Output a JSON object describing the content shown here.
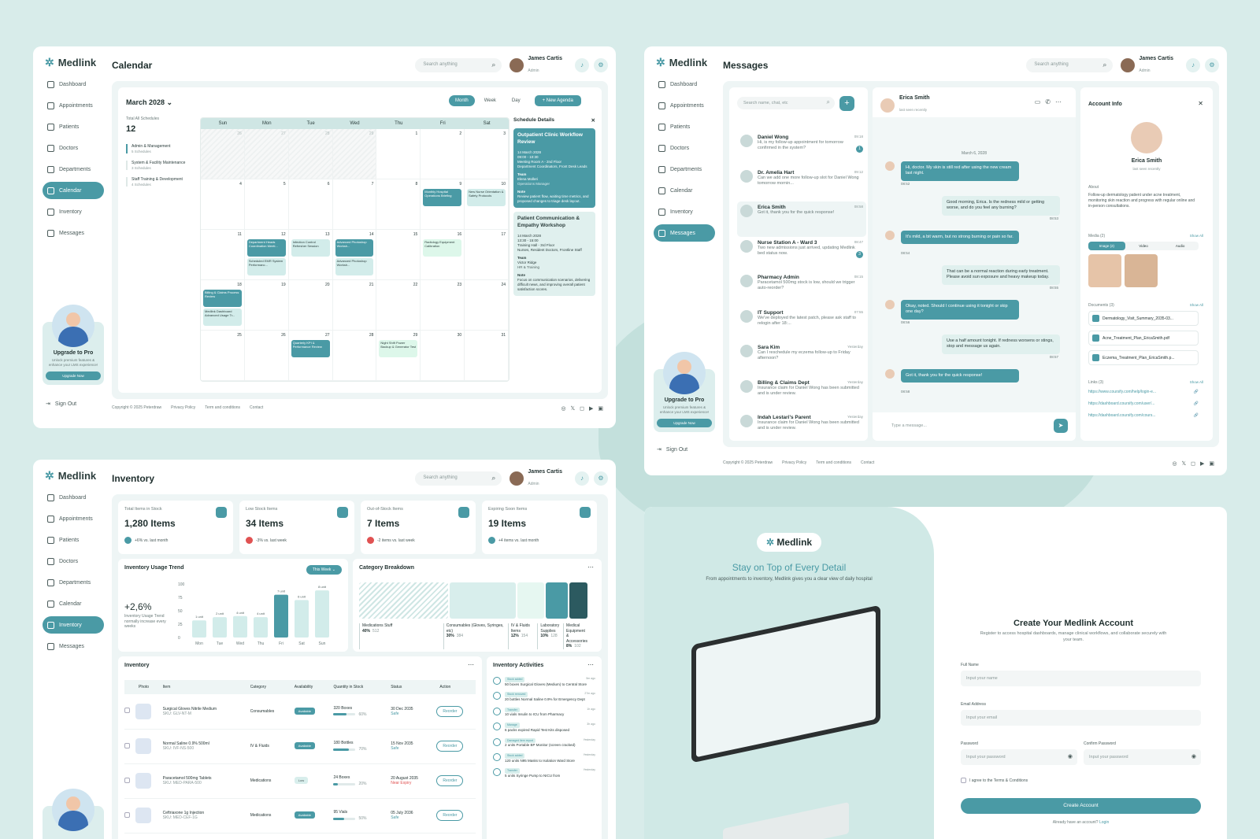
{
  "brand": "Medlink",
  "user": {
    "name": "James Cartis",
    "role": "Admin"
  },
  "search_placeholder": "Search anything",
  "nav": [
    "Dashboard",
    "Appointments",
    "Patients",
    "Doctors",
    "Departments",
    "Calendar",
    "Inventory",
    "Messages"
  ],
  "upgrade": {
    "title": "Upgrade to Pro",
    "text": "Unlock premium features & enhance your LMS experience!",
    "button": "Upgrade Now"
  },
  "signout": "Sign Out",
  "footer": {
    "copy": "Copyright © 2025 Peterdraw",
    "privacy": "Privacy Policy",
    "terms": "Term and conditions",
    "contact": "Contact"
  },
  "calendar": {
    "title": "Calendar",
    "month": "March 2028",
    "views": [
      "Month",
      "Week",
      "Day"
    ],
    "new_agenda": "+ New Agenda",
    "total_label": "Total All Schedules",
    "total": "12",
    "groups": [
      {
        "name": "Admin & Management",
        "count": "5 Schedules"
      },
      {
        "name": "System & Facility Maintenance",
        "count": "3 Schedules"
      },
      {
        "name": "Staff Training & Development",
        "count": "4 Schedules"
      }
    ],
    "weekdays": [
      "Sun",
      "Mon",
      "Tue",
      "Wed",
      "Thu",
      "Fri",
      "Sat"
    ],
    "days": [
      "26",
      "27",
      "28",
      "29",
      "1",
      "2",
      "3",
      "4",
      "5",
      "6",
      "7",
      "8",
      "9",
      "10",
      "11",
      "12",
      "13",
      "14",
      "15",
      "16",
      "17",
      "18",
      "19",
      "20",
      "21",
      "22",
      "23",
      "24",
      "25",
      "26",
      "27",
      "28",
      "29",
      "30",
      "31"
    ],
    "events": [
      {
        "day": "9",
        "text": "Monthly Hospital Operations Briefing",
        "style": "d"
      },
      {
        "day": "10",
        "text": "New Nurse Orientation & Safety Protocols",
        "style": "l"
      },
      {
        "day": "12",
        "text": "Department Heads Coordination Meeti...",
        "style": "d"
      },
      {
        "day": "12",
        "text": "Scheduled EMR System Performanc...",
        "style": "l"
      },
      {
        "day": "13",
        "text": "Infection Control Refresher Session",
        "style": "l"
      },
      {
        "day": "14",
        "text": "Advanced Photoshop Worksh...",
        "style": "d"
      },
      {
        "day": "14",
        "text": "Advanced Photoshop Worksh...",
        "style": "l"
      },
      {
        "day": "16",
        "text": "Radiology Equipment Calibration",
        "style": "g"
      },
      {
        "day": "18",
        "text": "Billing & Claims Process Review",
        "style": "d"
      },
      {
        "day": "18",
        "text": "Medlink Dashboard Advanced Usage Tr...",
        "style": "l"
      },
      {
        "day": "27",
        "text": "Quarterly KPI & Performance Review",
        "style": "d"
      },
      {
        "day": "29",
        "text": "Night Shift Power Backup & Generator Test",
        "style": "g"
      }
    ],
    "details_title": "Schedule Details",
    "details": [
      {
        "title": "Outpatient Clinic Workflow Review",
        "date": "14 March 2028",
        "time": "09:00 - 10:30",
        "place": "Meeting Room A - 2nd Floor",
        "who": "Department Coordinators, Front Desk Leads",
        "team": "Elena Molleri",
        "team_role": "Operations Manager",
        "note": "Review patient flow, waiting time metrics, and proposed changes to triage desk layout."
      },
      {
        "title": "Patient Communication & Empathy Workshop",
        "date": "14 March 2028",
        "time": "13:30 - 15:00",
        "place": "Training Hall - 3rd Floor",
        "who": "Nurses, Resident Doctors, Frontline Staff",
        "team": "Victor Ridge",
        "team_role": "HR & Training",
        "note": "Focus on communication scenarios, delivering difficult news, and improving overall patient satisfaction scores."
      }
    ]
  },
  "messages": {
    "title": "Messages",
    "search": "Search name, chat, etc",
    "chats": [
      {
        "name": "Daniel Wong",
        "time": "09:18",
        "text": "Hi, is my follow-up appointment for tomorrow confirmed in the system?",
        "badge": "1"
      },
      {
        "name": "Dr. Amelia Hart",
        "time": "09:12",
        "text": "Can we add one more follow-up slot for Daniel Wong tomorrow mornin...",
        "badge": ""
      },
      {
        "name": "Erica Smith",
        "time": "08:58",
        "text": "Got it, thank you for the quick response!",
        "badge": ""
      },
      {
        "name": "Nurse Station A - Ward 3",
        "time": "08:47",
        "text": "Two new admissions just arrived, updating Medlink bed status now.",
        "badge": "3"
      },
      {
        "name": "Pharmacy Admin",
        "time": "08:15",
        "text": "Paracetamol 500mg stock is low, should we trigger auto-reorder?",
        "badge": ""
      },
      {
        "name": "IT Support",
        "time": "07:55",
        "text": "We've deployed the latest patch, please ask staff to relogin after 18:...",
        "badge": ""
      },
      {
        "name": "Sara Kim",
        "time": "Yesterday",
        "text": "Can I reschedule my eczema follow-up to Friday afternoon?",
        "badge": ""
      },
      {
        "name": "Billing & Claims Dept",
        "time": "Yesterday",
        "text": "Insurance claim for Daniel Wong has been submitted and is under review.",
        "badge": ""
      },
      {
        "name": "Indah Lestari's Parent",
        "time": "Yesterday",
        "text": "Insurance claim for Daniel Wong has been submitted and is under review.",
        "badge": ""
      }
    ],
    "contact": {
      "name": "Erica Smith",
      "status": "last seen recently"
    },
    "date": "March 6, 2028",
    "thread": [
      {
        "dir": "in",
        "text": "Hi, doctor. My skin is still red after using the new cream last night.",
        "time": "08:52"
      },
      {
        "dir": "out",
        "text": "Good morning, Erica. Is the redness mild or getting worse, and do you feel any burning?",
        "time": "08:53"
      },
      {
        "dir": "in",
        "text": "It's mild, a bit warm, but no strong burning or pain so far.",
        "time": "08:54"
      },
      {
        "dir": "out",
        "text": "That can be a normal reaction during early treatment. Please avoid sun exposure and heavy makeup today.",
        "time": "08:55"
      },
      {
        "dir": "in",
        "text": "Okay, noted. Should I continue using it tonight or skip one day?",
        "time": "08:56"
      },
      {
        "dir": "out",
        "text": "Use a half amount tonight. If redness worsens or stings, stop and message us again.",
        "time": "08:57"
      },
      {
        "dir": "in",
        "text": "Got it, thank you for the quick response!",
        "time": "08:58"
      }
    ],
    "input": "Type a message...",
    "account": {
      "title": "Account Info",
      "name": "Erica Smith",
      "status": "last seen recently",
      "about_label": "About",
      "about": "Follow-up dermatology patient under acne treatment, monitoring skin reaction and progress with regular online and in-person consultations.",
      "media_label": "Media (2)",
      "show_all": "Show All",
      "tabs": [
        "Image (2)",
        "Video",
        "Audio"
      ],
      "docs_label": "Documents (3)",
      "docs": [
        "Dermatology_Visit_Summary_2035-03...",
        "Acne_Treatment_Plan_EricaSmith.pdf",
        "Eczema_Treatment_Plan_EricaSmith.p..."
      ],
      "links_label": "Links (3)",
      "links": [
        "https://www.coursify.com/help/login-e...",
        "https://dashboard.coursify.com/user/...",
        "https://dashboard.coursify.com/cours..."
      ]
    }
  },
  "inventory": {
    "title": "Inventory",
    "kpis": [
      {
        "label": "Total Items in Stock",
        "value": "1,280 Items",
        "change": "+6% vs. last month",
        "color": "#4a9aa5"
      },
      {
        "label": "Low Stock Items",
        "value": "34 Items",
        "change": "-3% vs. last week",
        "color": "#e05252"
      },
      {
        "label": "Out-of-Stock Items",
        "value": "7 Items",
        "change": "-2 items vs. last week",
        "color": "#e05252"
      },
      {
        "label": "Expiring Soon Items",
        "value": "19 Items",
        "change": "+4 items vs. last month",
        "color": "#4a9aa5"
      }
    ],
    "trend": {
      "title": "Inventory Usage Trend",
      "range": "This Week",
      "value": "+2,6%",
      "desc": "Inventory Usage Trend normally increase every weeks"
    },
    "chart_data": {
      "type": "bar",
      "categories": [
        "Mon",
        "Tue",
        "Wed",
        "Thu",
        "Fri",
        "Sat",
        "Sun"
      ],
      "values": [
        32,
        38,
        40,
        38,
        80,
        70,
        88
      ],
      "labels": [
        "1 unit",
        "2 unit",
        "4 unit",
        "4 unit",
        "7 unit",
        "6 unit",
        "8 unit"
      ],
      "yticks": [
        "100",
        "75",
        "50",
        "25",
        "0"
      ],
      "ylim": [
        0,
        100
      ]
    },
    "breakdown": {
      "title": "Category Breakdown",
      "items": [
        {
          "name": "Medications Stuff",
          "pct": "40%",
          "n": "512"
        },
        {
          "name": "Consumables (Gloves, Syringes, etc)",
          "pct": "30%",
          "n": "384"
        },
        {
          "name": "IV & Fluids Items",
          "pct": "12%",
          "n": "154"
        },
        {
          "name": "Laboratory Supplies",
          "pct": "10%",
          "n": "128"
        },
        {
          "name": "Medical Equipment & Accessories",
          "pct": "8%",
          "n": "102"
        }
      ]
    },
    "table": {
      "title": "Inventory",
      "headers": [
        "Photo",
        "Item",
        "Category",
        "Availability",
        "Quantity in Stock",
        "Status",
        "Action"
      ],
      "rows": [
        {
          "item": "Surgical Gloves Nitrile Medium",
          "sku": "SKU: GLV-NT-M",
          "cat": "Consumables",
          "avail": "Available",
          "qty": "320 Boxes",
          "pct": "60%",
          "date": "30 Dec 2035",
          "status": "Safe",
          "action": "Reorder"
        },
        {
          "item": "Normal Saline 0.9% 500ml",
          "sku": "SKU: IVF-NS-500",
          "cat": "IV & Fluids",
          "avail": "Available",
          "qty": "180 Bottles",
          "pct": "70%",
          "date": "15 Nov 2035",
          "status": "Safe",
          "action": "Reorder"
        },
        {
          "item": "Paracetamol 500mg Tablets",
          "sku": "SKU: MED-PARA-500",
          "cat": "Medications",
          "avail": "Low",
          "qty": "24 Boxes",
          "pct": "20%",
          "date": "20 August 2035",
          "status": "Near Expiry",
          "action": "Reorder"
        },
        {
          "item": "Ceftriaxone 1g Injection",
          "sku": "SKU: MED-CEF-1G",
          "cat": "Medications",
          "avail": "Available",
          "qty": "95 Vials",
          "pct": "50%",
          "date": "05 July 2036",
          "status": "Safe",
          "action": "Reorder"
        }
      ]
    },
    "activities": {
      "title": "Inventory Activities",
      "items": [
        {
          "tag": "Stock added",
          "text": "50 boxes Surgical Gloves (Medium) to Central Store",
          "time": "5m ago"
        },
        {
          "tag": "Stock removed",
          "text": "20 bottles Normal Saline 0.9% for Emergency Dept",
          "time": "27m ago"
        },
        {
          "tag": "Transfer",
          "text": "10 vials Insulin to ICU from Pharmacy",
          "time": "1h ago"
        },
        {
          "tag": "Manage",
          "text": "6 packs expired Rapid Test Kits disposed",
          "time": "3h ago"
        },
        {
          "tag": "Damaged item report",
          "text": "2 units Portable BP Monitor (screen cracked)",
          "time": "Yesterday"
        },
        {
          "tag": "Stock added",
          "text": "120 units N95 Masks to Isolation Ward Store",
          "time": "Yesterday"
        },
        {
          "tag": "Transfer",
          "text": "5 units Syringe Pump to NICU from",
          "time": "Yesterday"
        }
      ]
    }
  },
  "promo": {
    "headline": "Stay on Top of Every Detail",
    "sub": "From appointments to inventory, Medlink gives you a clear view of daily hospital"
  },
  "register": {
    "title": "Create Your Medlink Account",
    "sub": "Register to access hospital dashboards, manage clinical workflows, and collaborate securely with your team.",
    "name_label": "Full Name",
    "name_ph": "Input your name",
    "email_label": "Email Address",
    "email_ph": "Input your email",
    "pw_label": "Password",
    "pw_ph": "Input your password",
    "cpw_label": "Confirm Password",
    "cpw_ph": "Input your password",
    "agree": "I agree to the Terms & Conditions",
    "button": "Create Account",
    "have": "Already have an account?",
    "login": "Login"
  }
}
